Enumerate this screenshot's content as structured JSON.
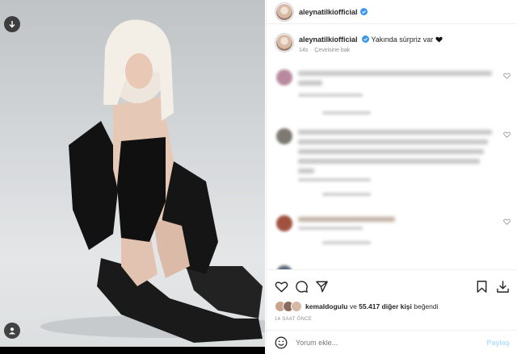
{
  "post": {
    "username": "aleynatilkiofficial",
    "caption_text": "Yakında sürpriz var",
    "caption_time": "14s",
    "translate_label": "Çevirisine bak",
    "likes_user": "kemaldogulu",
    "likes_connector": "ve",
    "likes_rest": "55.417 diğer kişi",
    "likes_suffix": "beğendi",
    "post_time": "14 SAAT ÖNCE",
    "comment_placeholder": "Yorum ekle...",
    "post_button": "Paylaş"
  },
  "icons": {
    "verified": "verified-badge-icon",
    "heart": "heart-icon",
    "comment": "comment-icon",
    "share": "share-icon",
    "bookmark": "bookmark-icon",
    "download": "download-icon",
    "emoji": "emoji-icon",
    "user_tag": "user-tag-icon",
    "media_download": "download-arrow-icon"
  },
  "colors": {
    "verified": "#3897f0",
    "text": "#262626",
    "muted": "#8e8e8e",
    "post_button": "#b2dffc"
  }
}
